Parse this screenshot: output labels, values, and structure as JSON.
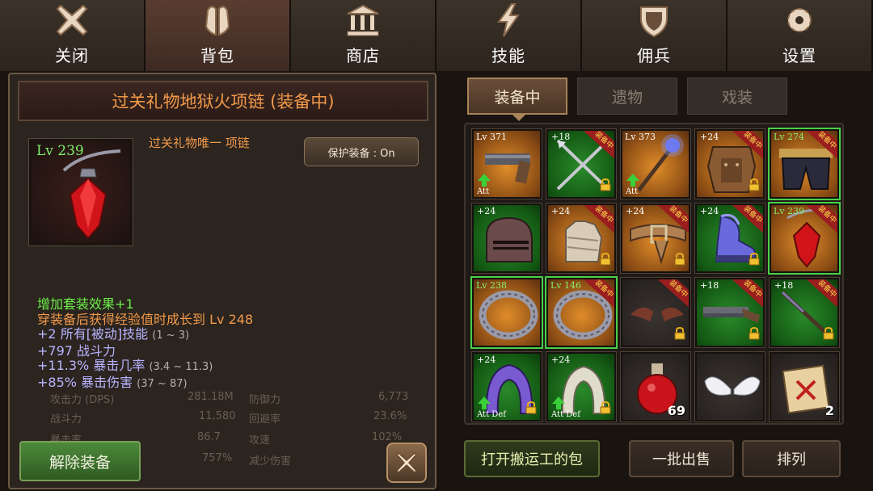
{
  "nav": {
    "tabs": [
      {
        "label": "关闭",
        "icon": "close-x-icon"
      },
      {
        "label": "背包",
        "icon": "backpack-icon",
        "active": true
      },
      {
        "label": "商店",
        "icon": "shop-building-icon"
      },
      {
        "label": "技能",
        "icon": "lightning-bolt-icon"
      },
      {
        "label": "佣兵",
        "icon": "shield-icon"
      },
      {
        "label": "设置",
        "icon": "gear-icon"
      }
    ]
  },
  "detail": {
    "title": "过关礼物地狱火项链 (装备中)",
    "level": "Lv 239",
    "item_type": "过关礼物唯一 项链",
    "protect_label": "保护装备 : On",
    "set_bonus_label": "增加套装效果",
    "set_bonus_value": "+1",
    "growth_text": "穿装备后获得经验值时成长到",
    "growth_level": "Lv 248",
    "stats": [
      {
        "value": "+2",
        "name": "所有[被动]技能",
        "range": "(1 ~ 3)"
      },
      {
        "value": "+797",
        "name": "战斗力",
        "range": ""
      },
      {
        "value": "+11.3%",
        "name": "暴击几率",
        "range": "(3.4 ~ 11.3)"
      },
      {
        "value": "+85%",
        "name": "暴击伤害",
        "range": "(37 ~ 87)"
      }
    ],
    "faded_stats": [
      {
        "label": "攻击力 (DPS)",
        "value": "281.18M",
        "label2": "防御力",
        "value2": "6,773"
      },
      {
        "label": "战斗力",
        "value": "11,580",
        "label2": "回避率",
        "value2": "23.6%"
      },
      {
        "label": "暴击率",
        "value": "86.7",
        "label2": "攻速",
        "value2": "102%"
      },
      {
        "label": "",
        "value": "757%",
        "label2": "减少伤害",
        "value2": ""
      }
    ],
    "unequip_label": "解除装备"
  },
  "inventory": {
    "subtabs": [
      "装备中",
      "遗物",
      "戏装"
    ],
    "equipped_ribbon": "装备中",
    "slots": [
      {
        "bg": "orange",
        "level": "Lv 371",
        "tag": "Att",
        "icon": "pistol-icon"
      },
      {
        "bg": "green",
        "plus": "+18",
        "equipped": true,
        "lock": true,
        "icon": "crossed-spears-icon"
      },
      {
        "bg": "orange",
        "level": "Lv 373",
        "tag": "Att",
        "icon": "magic-staff-icon"
      },
      {
        "bg": "orange",
        "plus": "+24",
        "equipped": true,
        "lock": true,
        "icon": "leather-armor-icon"
      },
      {
        "bg": "orange",
        "level": "Lv 274",
        "levelGreen": true,
        "equipped": true,
        "greenframe": true,
        "icon": "belt-pants-icon"
      },
      {
        "bg": "green",
        "plus": "+24",
        "icon": "knight-helmet-icon"
      },
      {
        "bg": "orange",
        "plus": "+24",
        "equipped": true,
        "lock": true,
        "icon": "bandaged-glove-icon"
      },
      {
        "bg": "orange",
        "plus": "+24",
        "equipped": true,
        "lock": true,
        "icon": "leather-belt-icon"
      },
      {
        "bg": "green",
        "plus": "+24",
        "equipped": true,
        "lock": true,
        "icon": "wizard-boot-icon"
      },
      {
        "bg": "orange",
        "level": "Lv 239",
        "levelGreen": true,
        "equipped": true,
        "greenframe": true,
        "icon": "red-gem-necklace-icon"
      },
      {
        "bg": "orange",
        "level": "Lv 238",
        "levelGreen": true,
        "greenframe": true,
        "icon": "iron-ring-icon"
      },
      {
        "bg": "orange",
        "level": "Lv 146",
        "levelGreen": true,
        "equipped": true,
        "greenframe": true,
        "icon": "iron-ring-icon"
      },
      {
        "bg": "gray",
        "equipped": true,
        "lock": true,
        "icon": "bat-wings-icon"
      },
      {
        "bg": "green",
        "plus": "+18",
        "equipped": true,
        "lock": true,
        "icon": "shotgun-icon"
      },
      {
        "bg": "green",
        "plus": "+18",
        "equipped": true,
        "lock": true,
        "icon": "rifle-icon"
      },
      {
        "bg": "green",
        "plus": "+24",
        "tag": "Att  Def",
        "lock": true,
        "icon": "purple-hood-icon"
      },
      {
        "bg": "green",
        "plus": "+24",
        "tag": "Att  Def",
        "lock": true,
        "icon": "cloth-hood-icon"
      },
      {
        "bg": "gray",
        "count": "69",
        "icon": "red-potion-icon"
      },
      {
        "bg": "gray",
        "icon": "angel-wings-icon"
      },
      {
        "bg": "gray",
        "count": "2",
        "icon": "scroll-icon"
      }
    ]
  },
  "buttons": {
    "open_porter": "打开搬运工的包",
    "bulk_sell": "一批出售",
    "sort": "排列"
  }
}
